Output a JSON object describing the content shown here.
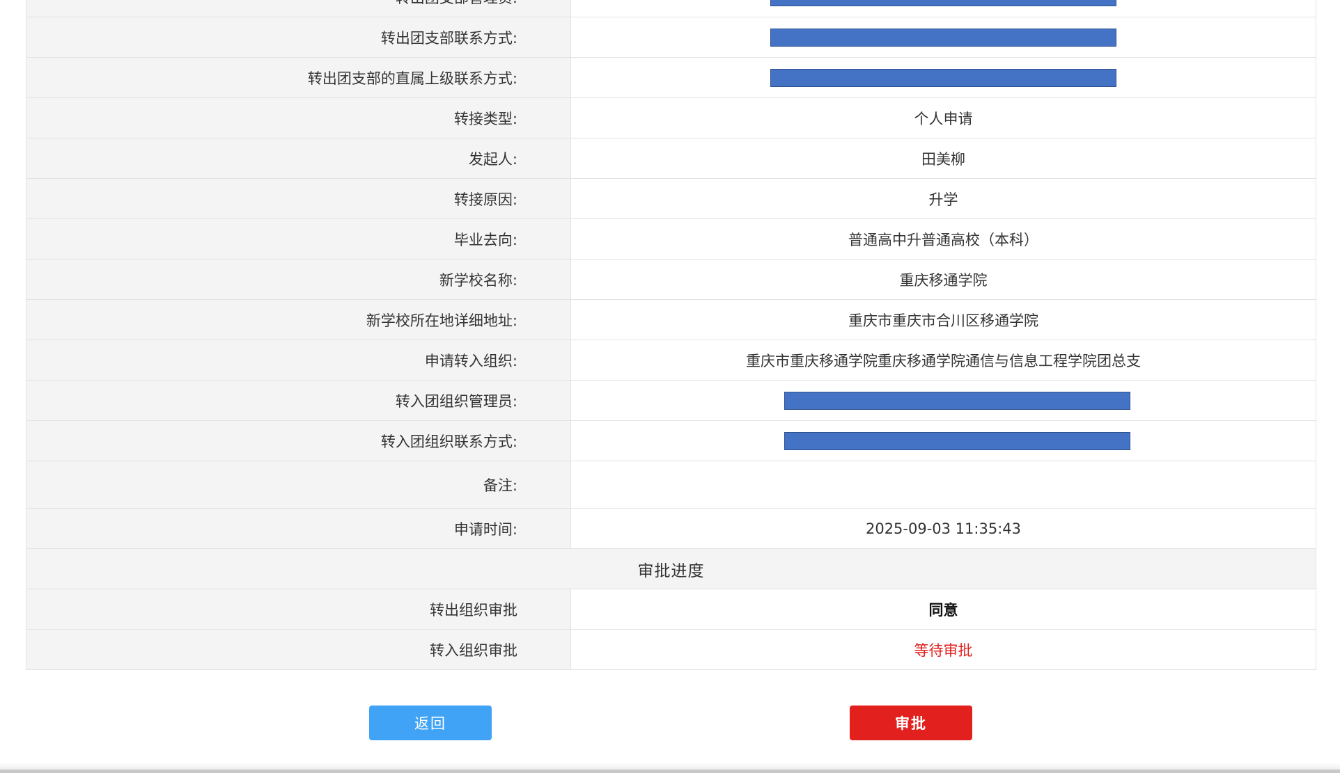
{
  "rows": [
    {
      "label": "转出团支部管理员:",
      "value": ""
    },
    {
      "label": "转出团支部联系方式:",
      "value": ""
    },
    {
      "label": "转出团支部的直属上级联系方式:",
      "value": ""
    },
    {
      "label": "转接类型:",
      "value": "个人申请"
    },
    {
      "label": "发起人:",
      "value": "田美柳"
    },
    {
      "label": "转接原因:",
      "value": "升学"
    },
    {
      "label": "毕业去向:",
      "value": "普通高中升普通高校（本科）"
    },
    {
      "label": "新学校名称:",
      "value": "重庆移通学院"
    },
    {
      "label": "新学校所在地详细地址:",
      "value": "重庆市重庆市合川区移通学院"
    },
    {
      "label": "申请转入组织:",
      "value": "重庆市重庆移通学院重庆移通学院通信与信息工程学院团总支"
    },
    {
      "label": "转入团组织管理员:",
      "value": ""
    },
    {
      "label": "转入团组织联系方式:",
      "value": ""
    },
    {
      "label": "备注:",
      "value": ""
    },
    {
      "label": "申请时间:",
      "value": "2025-09-03 11:35:43"
    }
  ],
  "progress": {
    "title": "审批进度",
    "out_label": "转出组织审批",
    "out_status": "同意",
    "in_label": "转入组织审批",
    "in_status": "等待审批"
  },
  "buttons": {
    "back": "返回",
    "approve": "审批"
  },
  "colors": {
    "redaction": "#4472c4",
    "back_button": "#41a3f5",
    "approve_button": "#e2201d",
    "pending_text": "#e0201e"
  }
}
